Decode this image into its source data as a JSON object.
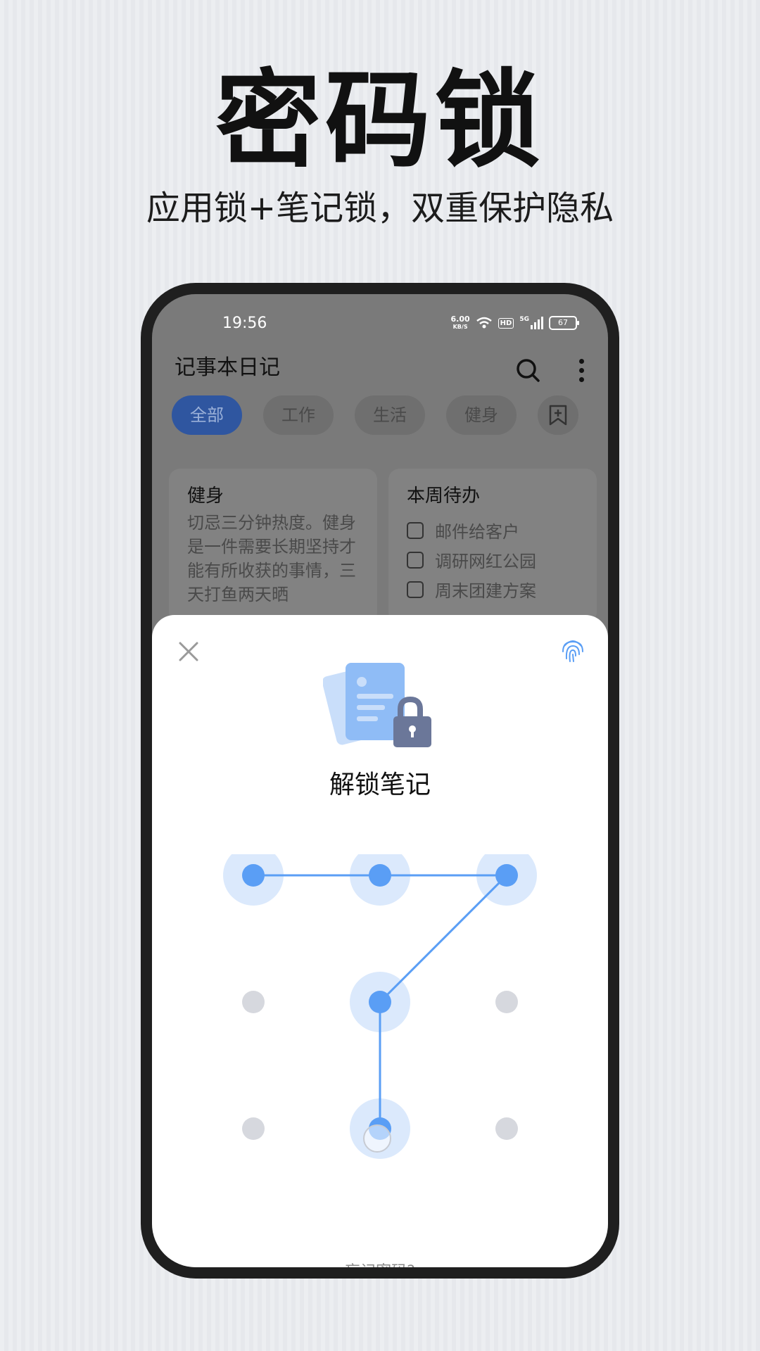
{
  "headline": "密码锁",
  "subline": "应用锁+笔记锁，双重保护隐私",
  "status": {
    "time": "19:56",
    "speed_value": "6.00",
    "speed_unit": "KB/S",
    "network": "5G",
    "hd": "HD",
    "battery": "67"
  },
  "app": {
    "title": "记事本日记",
    "chips": [
      "全部",
      "工作",
      "生活",
      "健身"
    ],
    "active_chip": "全部"
  },
  "cards": [
    {
      "title": "健身",
      "body": "切忌三分钟热度。健身是一件需要长期坚持才能有所收获的事情，三天打鱼两天晒"
    },
    {
      "title": "本周待办",
      "todos": [
        "邮件给客户",
        "调研网红公园",
        "周末团建方案"
      ]
    }
  ],
  "unlock": {
    "title": "解锁笔记",
    "forgot": "忘记密码?",
    "pattern_sequence": [
      1,
      2,
      3,
      5,
      8
    ],
    "colors": {
      "active_dot": "#5a9ef5",
      "active_halo": "#dbe9fc",
      "inactive_dot": "#d6d8de",
      "line": "#5a9ef5"
    }
  }
}
